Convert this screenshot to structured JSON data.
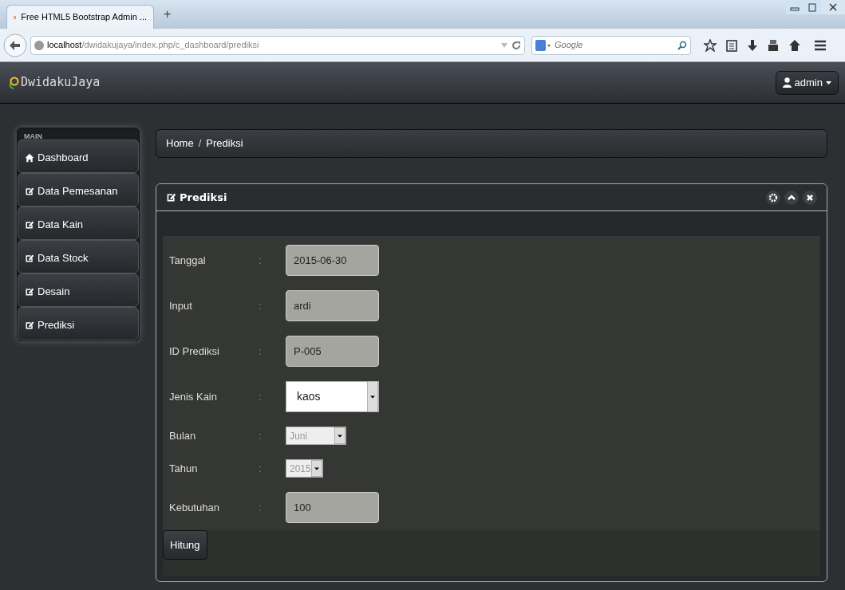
{
  "browser": {
    "tab_title": "Free HTML5 Bootstrap Admin ...",
    "new_tab": "+",
    "url_host": "localhost",
    "url_path": "/dwidakujaya/index.php/c_dashboard/prediksi",
    "search_placeholder": "Google"
  },
  "header": {
    "brand": "DwidakuJaya",
    "user": "admin"
  },
  "sidebar": {
    "heading": "MAIN",
    "items": [
      {
        "label": "Dashboard",
        "kind": "home"
      },
      {
        "label": "Data Pemesanan",
        "kind": "edit"
      },
      {
        "label": "Data Kain",
        "kind": "edit"
      },
      {
        "label": "Data Stock",
        "kind": "edit"
      },
      {
        "label": "Desain",
        "kind": "edit"
      },
      {
        "label": "Prediksi",
        "kind": "edit"
      }
    ]
  },
  "breadcrumb": [
    "Home",
    "/",
    "Prediksi"
  ],
  "panel": {
    "title": "Prediksi",
    "fields": [
      {
        "label": "Tanggal",
        "separator": ":",
        "kind": "text",
        "value": "2015-06-30"
      },
      {
        "label": "Input",
        "separator": ":",
        "kind": "text",
        "value": "ardi"
      },
      {
        "label": "ID Prediksi",
        "separator": ":",
        "kind": "text",
        "value": "P-005"
      },
      {
        "label": "Jenis Kain",
        "separator": ":",
        "kind": "select",
        "value": "kaos",
        "disabled": false
      },
      {
        "label": "Bulan",
        "separator": ":",
        "kind": "select",
        "value": "Juni",
        "disabled": true
      },
      {
        "label": "Tahun",
        "separator": ":",
        "kind": "select",
        "value": "2015",
        "disabled": true
      },
      {
        "label": "Kebutuhan",
        "separator": ":",
        "kind": "text",
        "value": "100"
      }
    ],
    "button": "Hitung"
  }
}
